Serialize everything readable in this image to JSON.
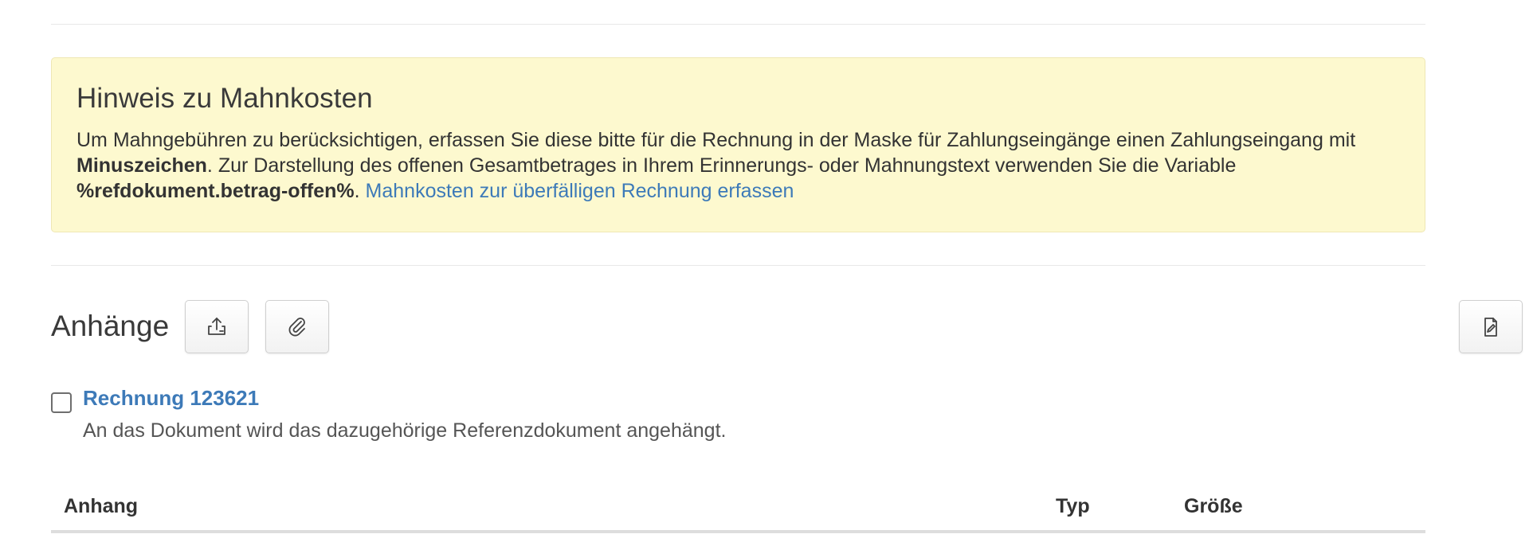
{
  "notice": {
    "title": "Hinweis zu Mahnkosten",
    "text_1": "Um Mahngebühren zu berücksichtigen, erfassen Sie diese bitte für die Rechnung in der Maske für Zahlungseingänge einen Zahlungseingang mit ",
    "bold_1": "Minuszeichen",
    "text_2": ". Zur Darstellung des offenen Gesamtbetrages in Ihrem Erinnerungs- oder Mahnungstext verwenden Sie die Variable ",
    "bold_2": "%refdokument.betrag-offen%",
    "text_3": ". ",
    "link": "Mahnkosten zur überfälligen Rechnung erfassen"
  },
  "attachments": {
    "title": "Anhänge",
    "buttons": [
      {
        "icon": "upload-icon"
      },
      {
        "icon": "paperclip-icon"
      }
    ],
    "right_button": {
      "icon": "file-edit-icon"
    },
    "reference": {
      "checked": false,
      "label": "Rechnung 123621",
      "description": "An das Dokument wird das dazugehörige Referenzdokument angehängt."
    },
    "table": {
      "columns": [
        "Anhang",
        "Typ",
        "Größe"
      ]
    }
  },
  "colors": {
    "notice_bg": "#fdf9cf",
    "link": "#3d7ab8",
    "text": "#333333"
  }
}
